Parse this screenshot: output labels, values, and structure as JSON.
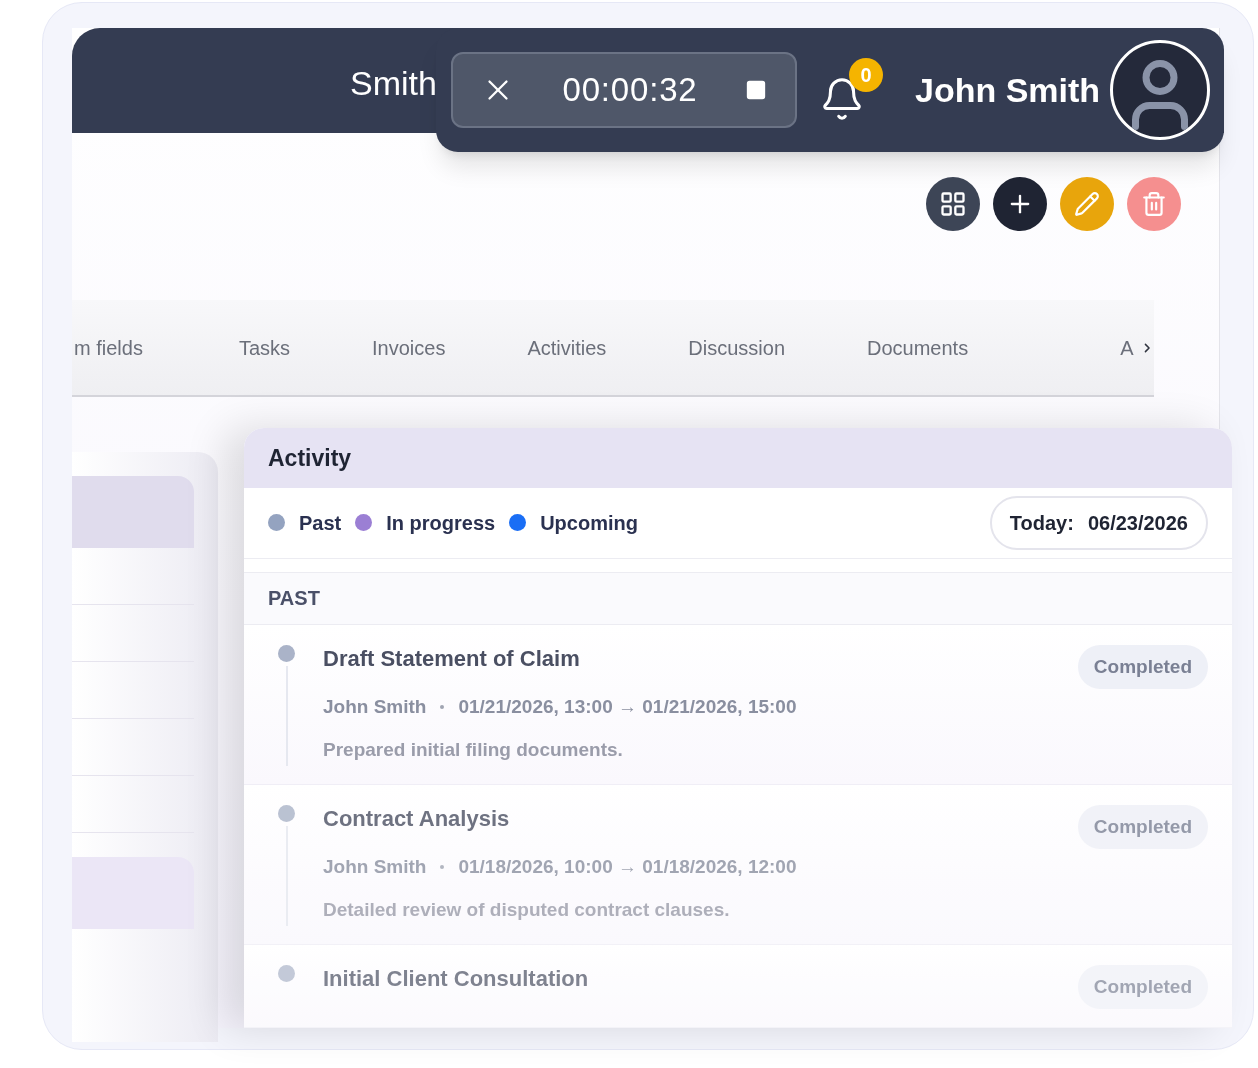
{
  "header": {
    "title": "Smith"
  },
  "recorder": {
    "time": "00:00:32"
  },
  "notifications": {
    "count": "0"
  },
  "user": {
    "name": "John Smith"
  },
  "tabs": [
    {
      "label": "m fields",
      "selected": false
    },
    {
      "label": "Tasks",
      "selected": false
    },
    {
      "label": "Invoices",
      "selected": false
    },
    {
      "label": "Activities",
      "selected": false
    },
    {
      "label": "Discussion",
      "selected": false
    },
    {
      "label": "Documents",
      "selected": false
    },
    {
      "label": "A",
      "selected": false
    }
  ],
  "activity": {
    "title": "Activity",
    "legend": [
      {
        "label": "Past",
        "color": "#94a3c0"
      },
      {
        "label": "In progress",
        "color": "#9b7fd4"
      },
      {
        "label": "Upcoming",
        "color": "#1a6ef5"
      }
    ],
    "today": {
      "label": "Today:",
      "value": "06/23/2026"
    },
    "section": "PAST",
    "items": [
      {
        "title": "Draft Statement of Claim",
        "author": "John Smith",
        "range": "01/21/2026, 13:00 → 01/21/2026, 15:00",
        "note": "Prepared initial filing documents.",
        "status": "Completed"
      },
      {
        "title": "Contract Analysis",
        "author": "John Smith",
        "range": "01/18/2026, 10:00 → 01/18/2026, 12:00",
        "note": "Detailed review of disputed contract clauses.",
        "status": "Completed"
      },
      {
        "title": "Initial Client Consultation",
        "status": "Completed"
      }
    ]
  }
}
